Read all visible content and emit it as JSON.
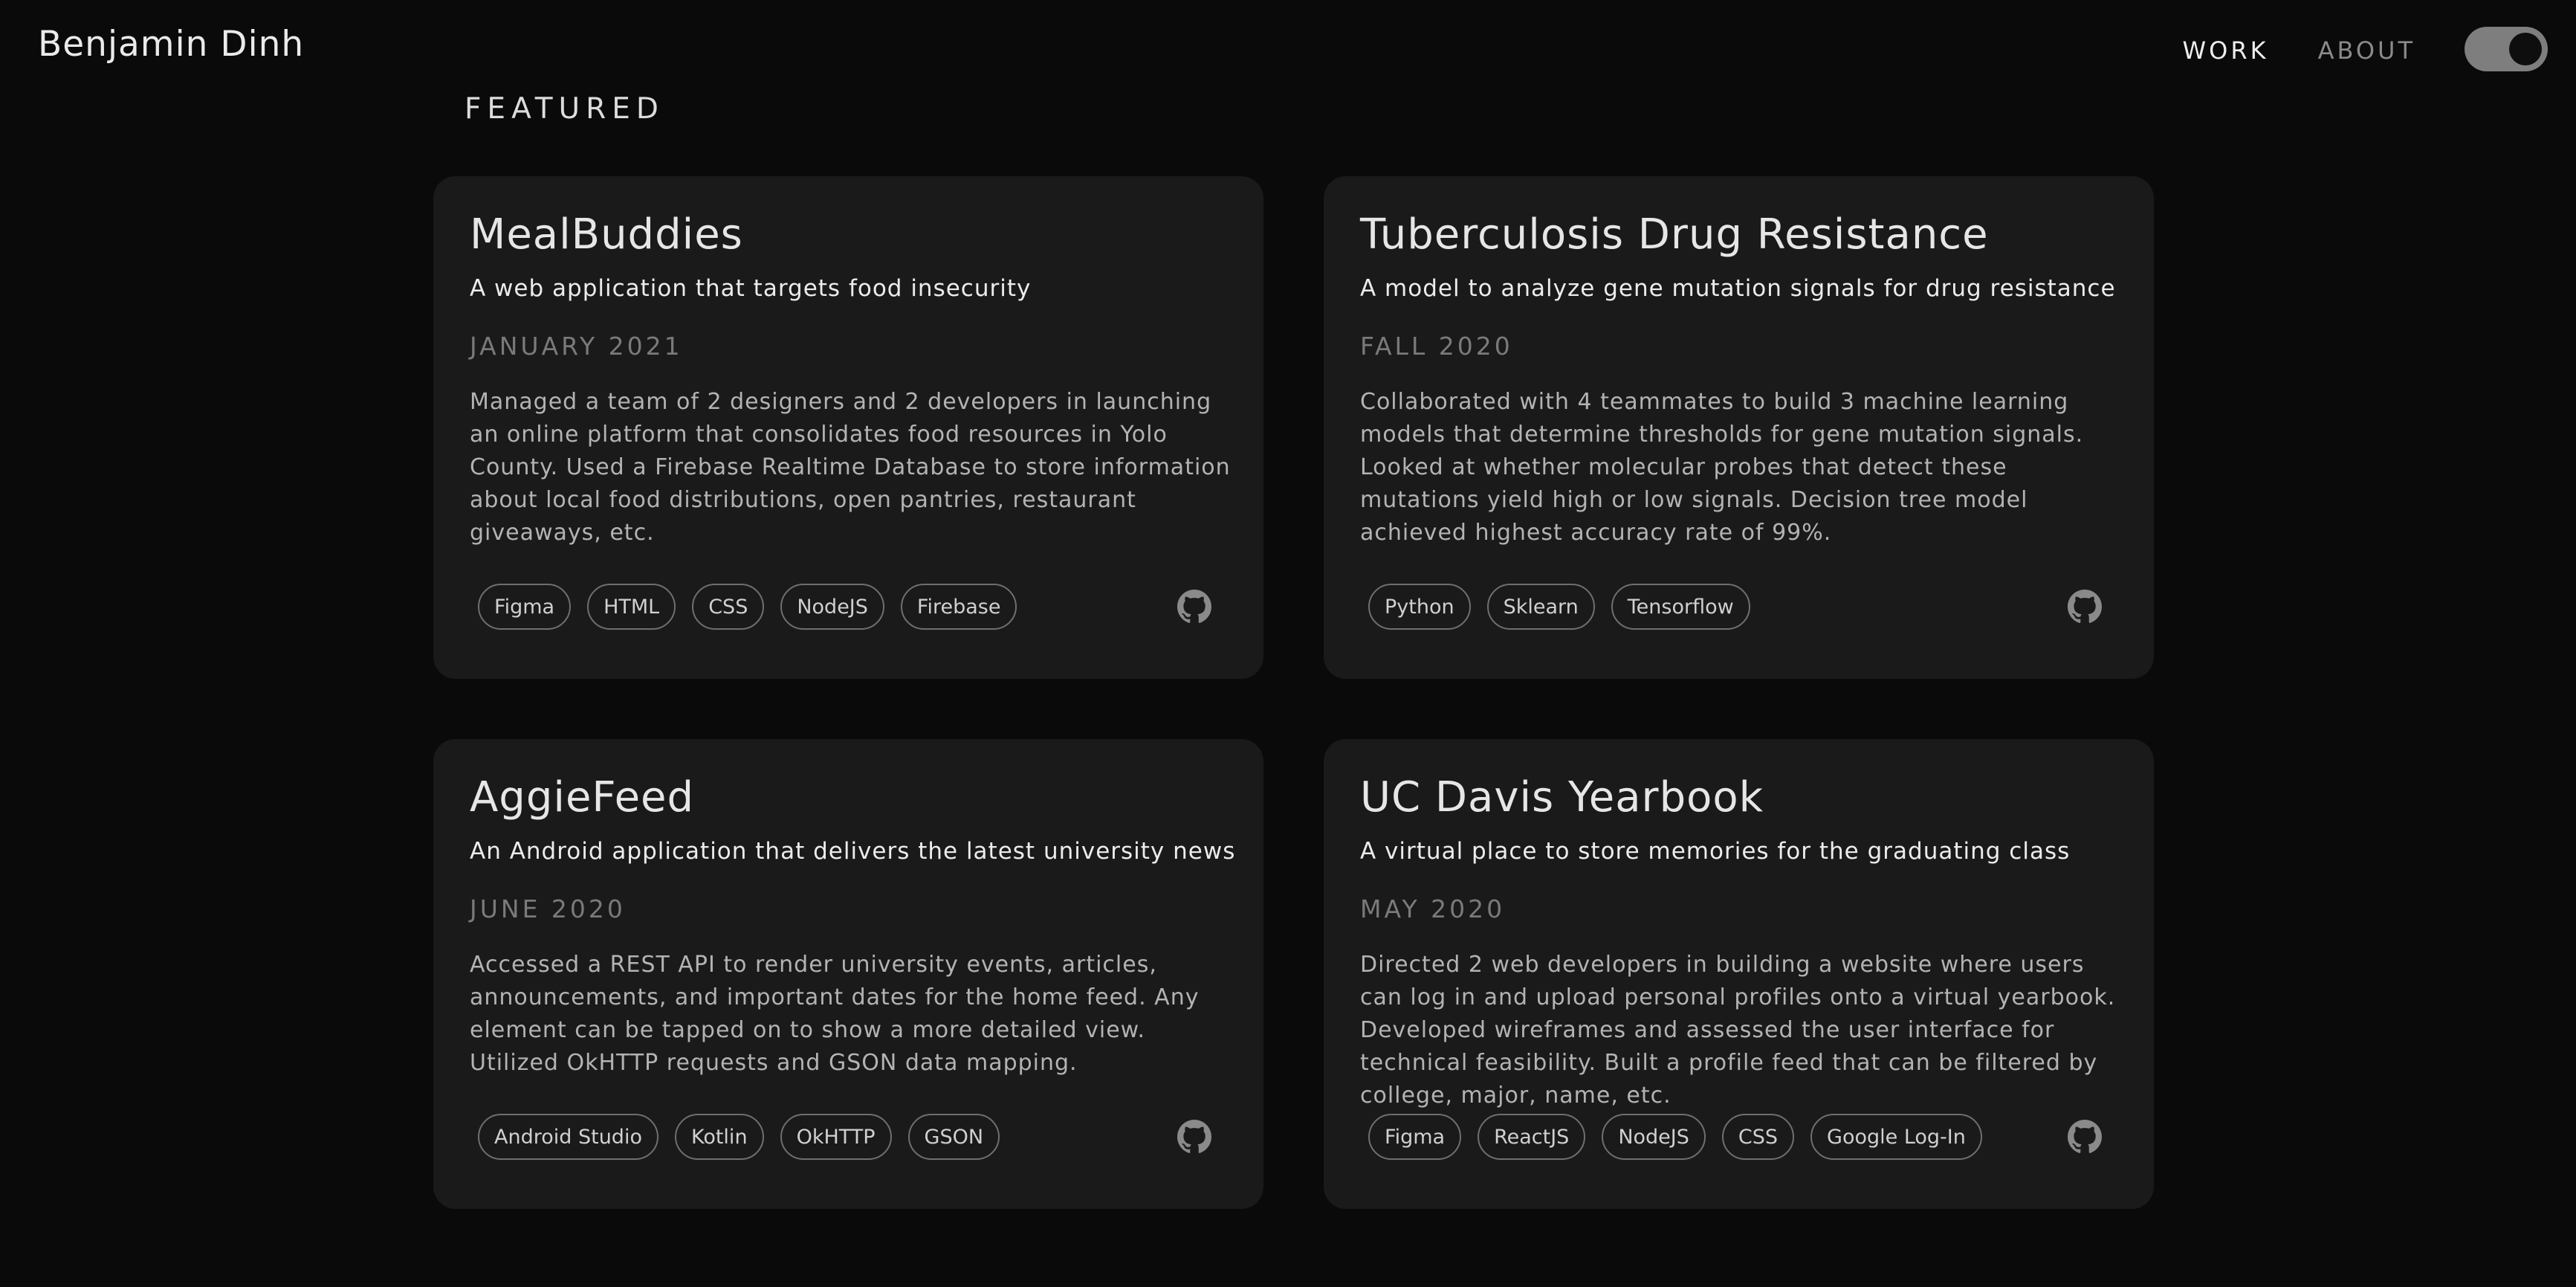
{
  "header": {
    "brand": "Benjamin Dinh",
    "nav": [
      {
        "label": "WORK",
        "active": true
      },
      {
        "label": "ABOUT",
        "active": false
      }
    ],
    "theme_toggle": {
      "state": "on"
    }
  },
  "section": {
    "title": "FEATURED"
  },
  "projects": [
    {
      "title": "MealBuddies",
      "subtitle": "A web application that targets food insecurity",
      "date": "JANUARY 2021",
      "description": "Managed a team of 2 designers and 2 developers in launching an online platform that consolidates food resources in Yolo County. Used a Firebase Realtime Database to store information about local food distributions, open pantries, restaurant giveaways, etc.",
      "tags": [
        "Figma",
        "HTML",
        "CSS",
        "NodeJS",
        "Firebase"
      ],
      "icon": "github-icon"
    },
    {
      "title": "Tuberculosis Drug Resistance",
      "subtitle": "A model to analyze gene mutation signals for drug resistance",
      "date": "FALL 2020",
      "description": "Collaborated with 4 teammates to build 3 machine learning models that determine thresholds for gene mutation signals. Looked at whether molecular probes that detect these mutations yield high or low signals. Decision tree model achieved highest accuracy rate of 99%.",
      "tags": [
        "Python",
        "Sklearn",
        "Tensorflow"
      ],
      "icon": "github-icon"
    },
    {
      "title": "AggieFeed",
      "subtitle": "An Android application that delivers the latest university news",
      "date": "JUNE 2020",
      "description": "Accessed a REST API to render university events, articles, announcements, and important dates for the home feed. Any element can be tapped on to show a more detailed view. Utilized OkHTTP requests and GSON data mapping.",
      "tags": [
        "Android Studio",
        "Kotlin",
        "OkHTTP",
        "GSON"
      ],
      "icon": "github-icon"
    },
    {
      "title": "UC Davis Yearbook",
      "subtitle": "A virtual place to store memories for the graduating class",
      "date": "MAY 2020",
      "description": "Directed 2 web developers in building a website where users can log in and upload personal profiles onto a virtual yearbook. Developed wireframes and assessed the user interface for technical feasibility. Built a profile feed that can be filtered by college, major, name, etc.",
      "tags": [
        "Figma",
        "ReactJS",
        "NodeJS",
        "CSS",
        "Google Log-In"
      ],
      "icon": "github-icon"
    }
  ],
  "colors": {
    "background": "#0a0a0a",
    "card": "#1a1a1a",
    "muted": "#7a7a7a",
    "toggle": "#7e7e7e"
  }
}
